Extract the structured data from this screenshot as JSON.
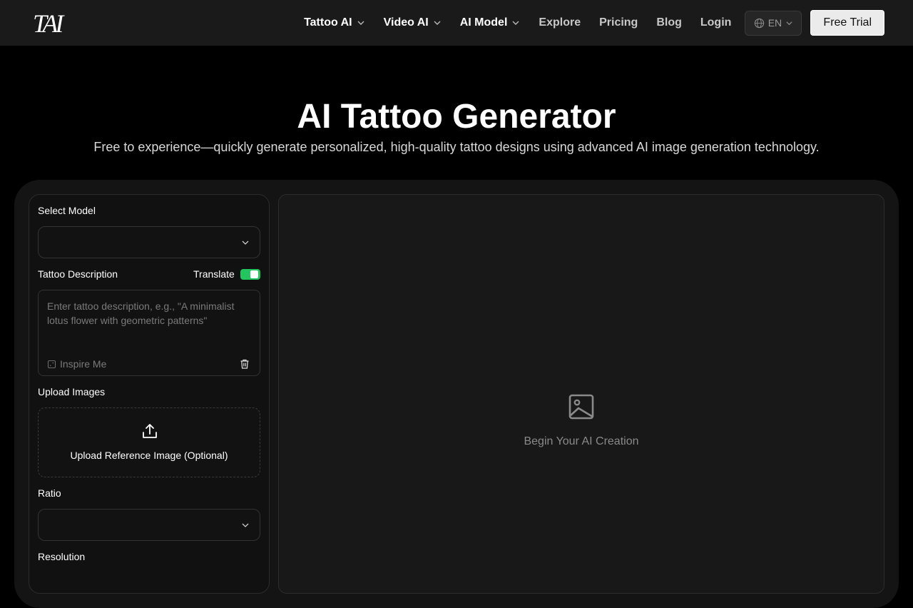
{
  "header": {
    "logo_text": "TAI",
    "nav": [
      {
        "label": "Tattoo AI",
        "has_dropdown": true
      },
      {
        "label": "Video AI",
        "has_dropdown": true
      },
      {
        "label": "AI Model",
        "has_dropdown": true
      },
      {
        "label": "Explore",
        "has_dropdown": false
      },
      {
        "label": "Pricing",
        "has_dropdown": false
      },
      {
        "label": "Blog",
        "has_dropdown": false
      },
      {
        "label": "Login",
        "has_dropdown": false
      }
    ],
    "language": "EN",
    "cta": "Free Trial"
  },
  "hero": {
    "title": "AI Tattoo Generator",
    "subtitle": "Free to experience—quickly generate personalized, high-quality tattoo designs using advanced AI image generation technology."
  },
  "form": {
    "model_label": "Select Model",
    "model_value": "",
    "description_label": "Tattoo Description",
    "translate_label": "Translate",
    "translate_on": true,
    "description_placeholder": "Enter tattoo description, e.g., \"A minimalist lotus flower with geometric patterns\"",
    "inspire_label": "Inspire Me",
    "upload_label": "Upload Images",
    "upload_text": "Upload Reference Image (Optional)",
    "ratio_label": "Ratio",
    "ratio_value": "",
    "resolution_label": "Resolution"
  },
  "preview": {
    "placeholder_text": "Begin Your AI Creation"
  },
  "colors": {
    "accent_toggle": "#22c55e",
    "background": "#000000",
    "card": "#141414"
  },
  "icons": {
    "logo": "tai-logo",
    "dropdown": "chevron-down-icon",
    "language": "globe-icon",
    "inspire": "dice-icon",
    "delete": "trash-icon",
    "upload": "upload-icon",
    "placeholder": "image-icon"
  }
}
